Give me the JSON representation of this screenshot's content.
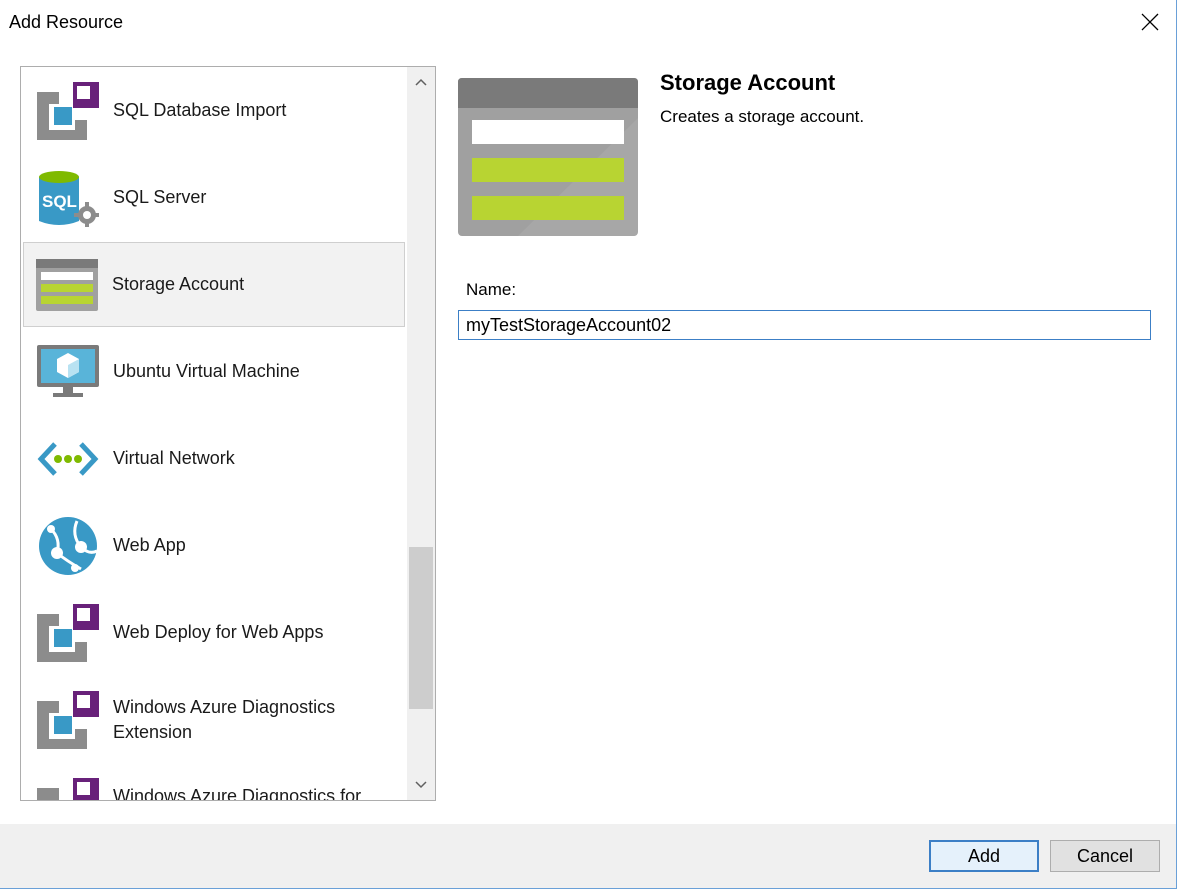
{
  "window": {
    "title": "Add Resource"
  },
  "resource_list": {
    "items": [
      {
        "label": "SQL Database Import",
        "icon": "puzzle-piece-icon",
        "selected": false
      },
      {
        "label": "SQL Server",
        "icon": "sql-server-icon",
        "selected": false
      },
      {
        "label": "Storage Account",
        "icon": "storage-account-icon",
        "selected": true
      },
      {
        "label": "Ubuntu Virtual Machine",
        "icon": "virtual-machine-icon",
        "selected": false
      },
      {
        "label": "Virtual Network",
        "icon": "virtual-network-icon",
        "selected": false
      },
      {
        "label": "Web App",
        "icon": "web-app-globe-icon",
        "selected": false
      },
      {
        "label": "Web Deploy for Web Apps",
        "icon": "puzzle-piece-icon",
        "selected": false
      },
      {
        "label": "Windows Azure Diagnostics Extension",
        "icon": "puzzle-piece-icon",
        "selected": false
      },
      {
        "label": "Windows Azure Diagnostics for",
        "icon": "puzzle-piece-icon",
        "selected": false
      }
    ],
    "sql_icon_text": "SQL"
  },
  "detail": {
    "title": "Storage Account",
    "description": "Creates a storage account.",
    "name_label": "Name:",
    "name_value": "myTestStorageAccount02"
  },
  "buttons": {
    "add": "Add",
    "cancel": "Cancel"
  },
  "colors": {
    "accent": "#3c7fc6",
    "storage_green": "#b8d432",
    "storage_gray": "#8c8c8c",
    "azure_blue": "#3999c6",
    "purple": "#68217a"
  }
}
